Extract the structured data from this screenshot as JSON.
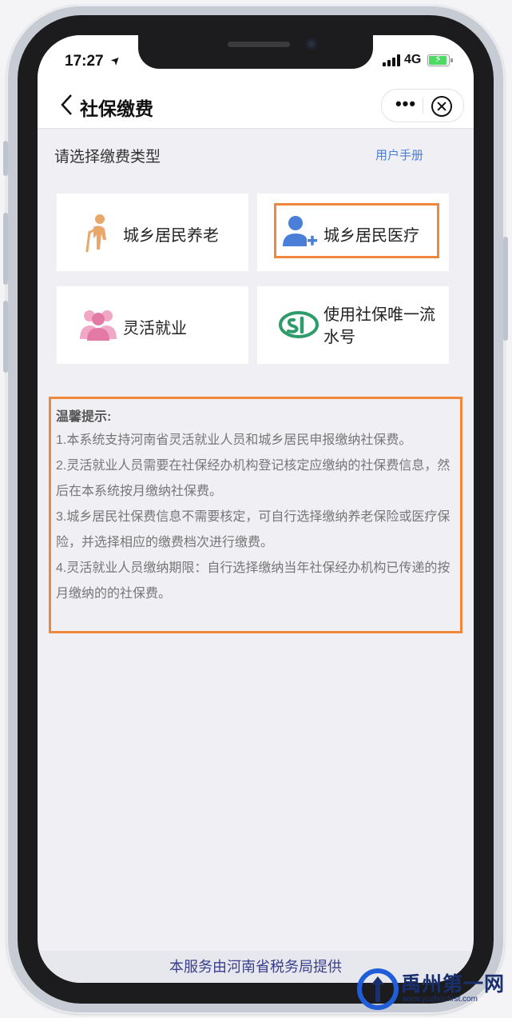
{
  "status_bar": {
    "time": "17:27",
    "location_arrow": "➤",
    "network": "4G"
  },
  "nav": {
    "title": "社保缴费",
    "more": "•••"
  },
  "header": {
    "label": "请选择缴费类型",
    "manual_link": "用户手册"
  },
  "tiles": [
    {
      "label": "城乡居民养老",
      "icon": "elderly-person-icon"
    },
    {
      "label": "城乡居民医疗",
      "icon": "add-user-icon"
    },
    {
      "label": "灵活就业",
      "icon": "people-group-icon"
    },
    {
      "label": "使用社保唯一流水号",
      "icon": "social-insurance-logo-icon"
    }
  ],
  "tips": {
    "title": "温馨提示:",
    "items": [
      "1.本系统支持河南省灵活就业人员和城乡居民申报缴纳社保费。",
      "2.灵活就业人员需要在社保经办机构登记核定应缴纳的社保费信息，然后在本系统按月缴纳社保费。",
      "3.城乡居民社保费信息不需要核定，可自行选择缴纳养老保险或医疗保险，并选择相应的缴费档次进行缴费。",
      "4.灵活就业人员缴纳期限：自行选择缴纳当年社保经办机构已传递的按月缴纳的的社保费。"
    ]
  },
  "footer": "本服务由河南省税务局提供",
  "watermark": {
    "brand": "禹州第一网",
    "url": "www.yuzhoufirst.com"
  },
  "colors": {
    "highlight": "#f0873a",
    "link": "#4a7fd8",
    "footer_text": "#3a3e8c",
    "accent_green": "#2e9b6a",
    "accent_pink": "#e37aa6"
  }
}
